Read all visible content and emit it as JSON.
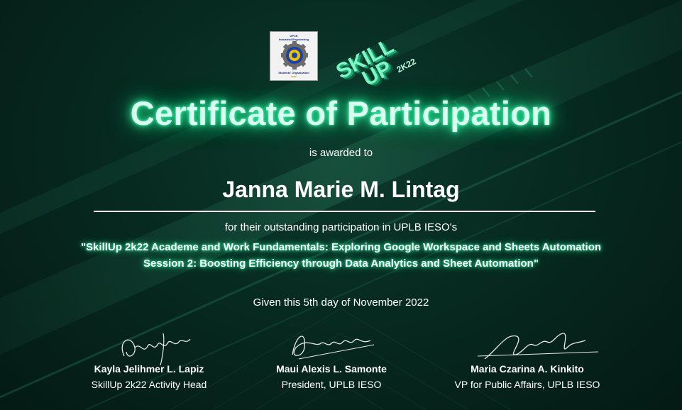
{
  "logos": {
    "ieso_top": "UPLB",
    "ieso_line2": "Industrial Engineering",
    "ieso_bottom": "Students' Organization",
    "ieso_est": "IESO",
    "skillup_word1": "SKILL",
    "skillup_word2": "UP",
    "skillup_year": "2K22"
  },
  "certificate": {
    "title": "Certificate of Participation",
    "awarded_text": "is awarded to",
    "recipient": "Janna Marie M. Lintag",
    "description": "for their outstanding participation in UPLB IESO's",
    "event_line1": "\"SkillUp 2k22 Academe and Work Fundamentals: Exploring Google Workspace and Sheets Automation",
    "event_line2": "Session 2: Boosting Efficiency through Data Analytics and Sheet Automation\"",
    "given": "Given this 5th day of November 2022"
  },
  "signatories": [
    {
      "name": "Kayla Jelihmer L. Lapiz",
      "role": "SkillUp 2k22 Activity Head"
    },
    {
      "name": "Maui Alexis L. Samonte",
      "role": "President, UPLB IESO"
    },
    {
      "name": "Maria Czarina A. Kinkito",
      "role": "VP for Public Affairs, UPLB IESO"
    }
  ],
  "colors": {
    "background": "#07241c",
    "glow": "#2cf59e",
    "text": "#ffffff"
  }
}
